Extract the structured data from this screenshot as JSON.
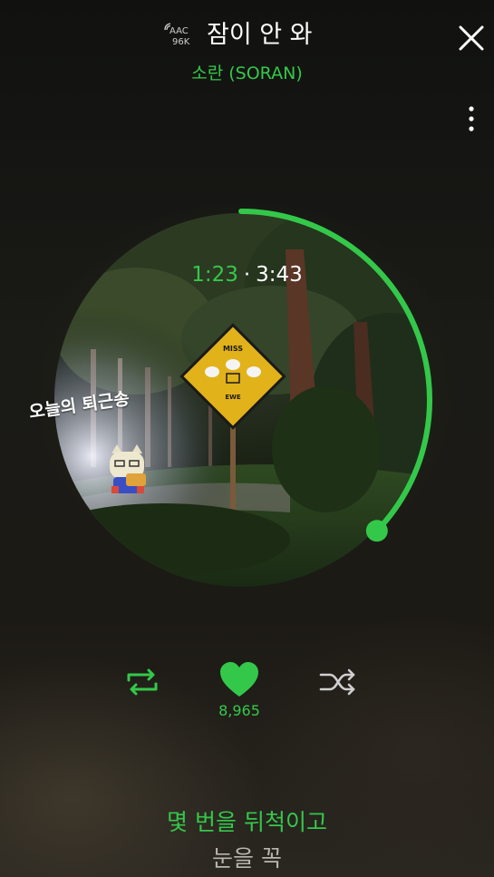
{
  "header": {
    "audio_codec": "AAC",
    "audio_bitrate": "96K",
    "song_title": "잠이 안 와",
    "artist": "소란 (SORAN)"
  },
  "icons": {
    "close": "close-icon",
    "more": "more-vertical-icon",
    "repeat": "repeat-icon",
    "like": "heart-icon",
    "shuffle": "shuffle-icon",
    "quality": "signal-wave-icon"
  },
  "album_art": {
    "overlay_label": "오늘의 퇴근송",
    "sign_top": "MISS",
    "sign_bottom": "EWE"
  },
  "playback": {
    "elapsed": "1:23",
    "separator": "·",
    "total": "3:43",
    "progress_fraction": 0.372
  },
  "controls": {
    "like_count": "8,965",
    "liked": true
  },
  "lyrics": {
    "current_line": "몇 번을 뒤척이고",
    "next_line": "눈을 꼭"
  },
  "colors": {
    "accent": "#34c84a",
    "text": "#ffffff",
    "muted": "#b8b6b0"
  }
}
